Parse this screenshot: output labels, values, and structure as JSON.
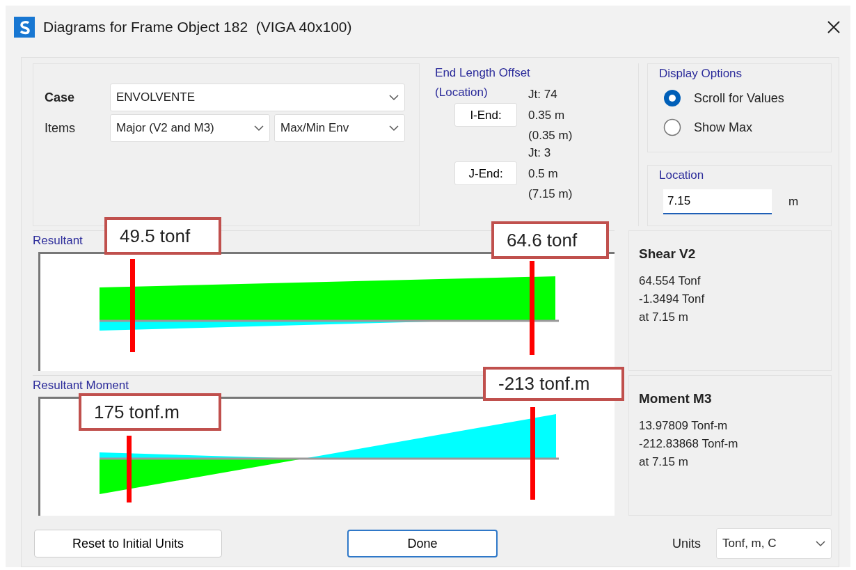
{
  "window": {
    "title": "Diagrams for Frame Object 182  (VIGA 40x100)"
  },
  "case": {
    "label": "Case",
    "value": "ENVOLVENTE"
  },
  "items": {
    "label": "Items",
    "values": [
      "Major (V2 and M3)",
      "Max/Min Env"
    ]
  },
  "end_length_offset": {
    "title": "End Length Offset\n(Location)",
    "ends": [
      {
        "button": "I-End:",
        "joint": "Jt:  74",
        "offset": "0.35 m",
        "location": "(0.35 m)"
      },
      {
        "button": "J-End:",
        "joint": "Jt:  3",
        "offset": "0.5 m",
        "location": "(7.15 m)"
      }
    ]
  },
  "display_options": {
    "title": "Display Options",
    "options": [
      {
        "label": "Scroll for Values",
        "selected": true
      },
      {
        "label": "Show Max",
        "selected": false
      }
    ]
  },
  "location": {
    "title": "Location",
    "value": "7.15",
    "unit": "m"
  },
  "diagrams": [
    {
      "kind": "shear",
      "label": "Resultant",
      "heading": "Shear V2",
      "lines": [
        "64.554 Tonf",
        "-1.3494 Tonf",
        "at 7.15 m"
      ]
    },
    {
      "kind": "moment",
      "label": "Resultant Moment",
      "heading": "Moment M3",
      "lines": [
        "13.97809 Tonf-m",
        "-212.83868 Tonf-m",
        "at 7.15 m"
      ]
    }
  ],
  "annotations": [
    {
      "text": "49.5 tonf"
    },
    {
      "text": "64.6 tonf"
    },
    {
      "text": "175 tonf.m"
    },
    {
      "text": "-213 tonf.m"
    }
  ],
  "footer": {
    "reset_button": "Reset to Initial Units",
    "done_button": "Done",
    "units_label": "Units",
    "units_value": "Tonf, m, C"
  }
}
